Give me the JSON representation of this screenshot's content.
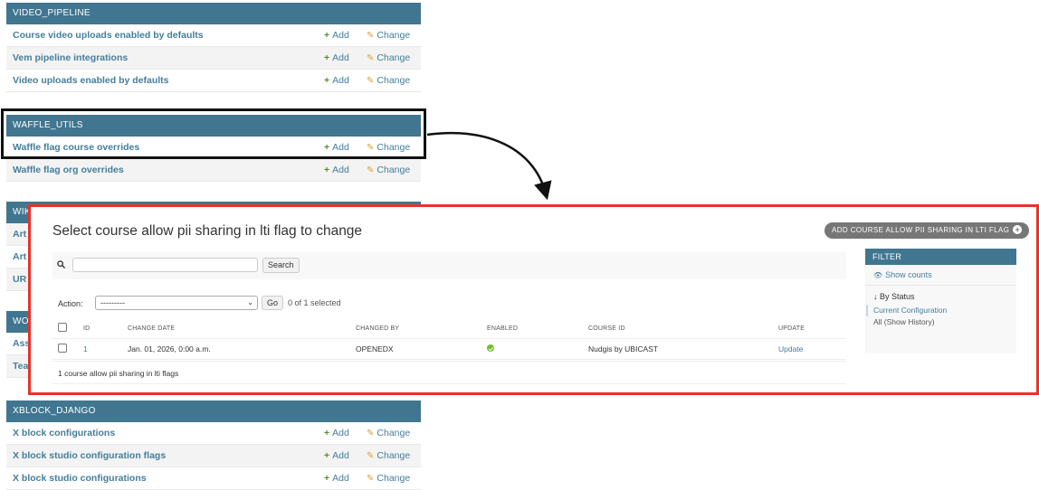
{
  "admin_index": {
    "add_label": "Add",
    "change_label": "Change",
    "modules": [
      {
        "header": "VIDEO_PIPELINE",
        "models": [
          "Course video uploads enabled by defaults",
          "Vem pipeline integrations",
          "Video uploads enabled by defaults"
        ]
      },
      {
        "header": "WAFFLE_UTILS",
        "models": [
          "Waffle flag course overrides",
          "Waffle flag org overrides"
        ]
      },
      {
        "header": "WIKI",
        "models": [
          "Article",
          "Article",
          "URL"
        ]
      },
      {
        "header": "WORKFLOW",
        "models": [
          "Assessment",
          "Team"
        ]
      },
      {
        "header": "XBLOCK_DJANGO",
        "models": [
          "X block configurations",
          "X block studio configuration flags",
          "X block studio configurations"
        ]
      }
    ],
    "partial_headers": {
      "wiki": "WIK",
      "workflow": "WO"
    },
    "partial_rows": {
      "wiki": [
        "Art",
        "Art",
        "UR"
      ],
      "workflow": [
        "Ass",
        "Tea"
      ]
    }
  },
  "changelist": {
    "title": "Select course allow pii sharing in lti flag to change",
    "add_button": "ADD COURSE ALLOW PII SHARING IN LTI FLAG",
    "search_button": "Search",
    "action_label": "Action:",
    "action_selected": "---------",
    "go_button": "Go",
    "selection_count": "0 of 1 selected",
    "columns": [
      "ID",
      "CHANGE DATE",
      "CHANGED BY",
      "ENABLED",
      "COURSE ID",
      "UPDATE"
    ],
    "rows": [
      {
        "id": "1",
        "change_date": "Jan. 01, 2026, 0:00 a.m.",
        "changed_by": "OPENEDX",
        "enabled": true,
        "course_id": "Nudgis by UBICAST",
        "update": "Update"
      }
    ],
    "result_count": "1 course allow pii sharing in lti flags",
    "filter": {
      "header": "FILTER",
      "show_counts": "Show counts",
      "by_status": "By Status",
      "options": [
        "Current Configuration",
        "All (Show History)"
      ]
    }
  },
  "colors": {
    "module_header": "#417690",
    "link": "#447e9b",
    "annotation_box": "#111111",
    "zoom_border": "#e8322a",
    "enabled_icon": "#70bf2b"
  }
}
